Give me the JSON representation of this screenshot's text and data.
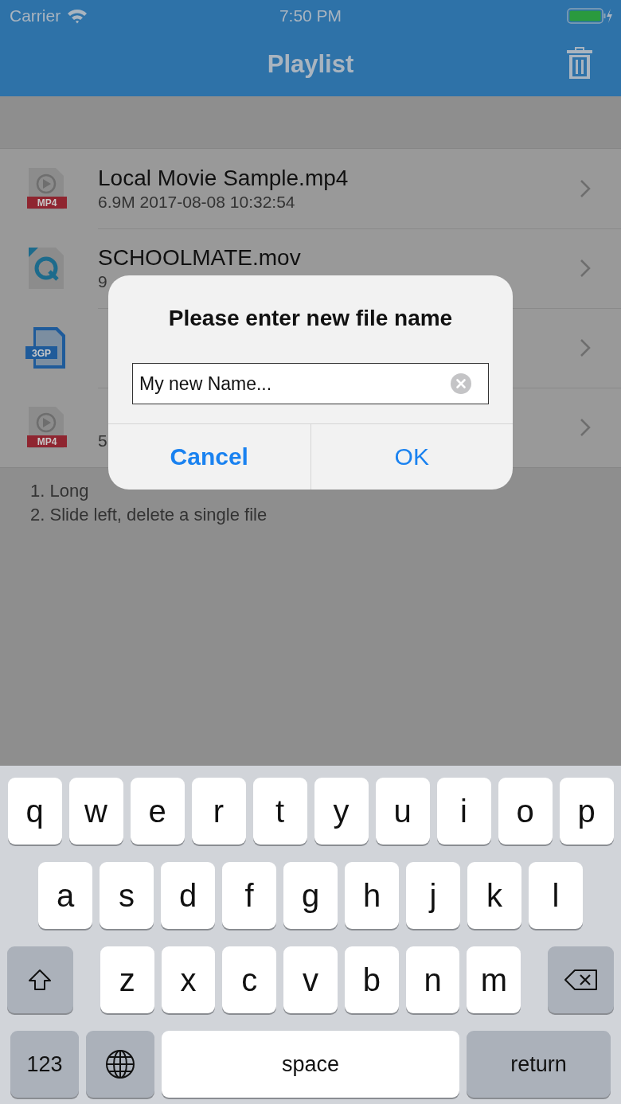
{
  "status_bar": {
    "carrier": "Carrier",
    "time": "7:50 PM"
  },
  "nav": {
    "title": "Playlist"
  },
  "files": [
    {
      "kind": "mp4",
      "icon_label": "MP4",
      "name": "Local Movie Sample.mp4",
      "detail": "6.9M  2017-08-08 10:32:54"
    },
    {
      "kind": "mov",
      "name": "SCHOOLMATE.mov",
      "detail": "9"
    },
    {
      "kind": "document",
      "icon_label": "3GP"
    },
    {
      "kind": "mp4",
      "icon_label": "MP4",
      "detail": "5"
    }
  ],
  "tips": [
    "1. Long",
    "2. Slide left, delete a single file"
  ],
  "dialog": {
    "title": "Please enter new file name",
    "field": {
      "value": "My new Name..."
    },
    "buttons": [
      {
        "label": "Cancel",
        "bold": true
      },
      {
        "label": "OK",
        "bold": false
      }
    ]
  },
  "keyboard": {
    "rows": [
      {
        "keys": [
          {
            "kind": "letter",
            "label": "q"
          },
          {
            "kind": "letter",
            "label": "w"
          },
          {
            "kind": "letter",
            "label": "e"
          },
          {
            "kind": "letter",
            "label": "r"
          },
          {
            "kind": "letter",
            "label": "t"
          },
          {
            "kind": "letter",
            "label": "y"
          },
          {
            "kind": "letter",
            "label": "u"
          },
          {
            "kind": "letter",
            "label": "i"
          },
          {
            "kind": "letter",
            "label": "o"
          },
          {
            "kind": "letter",
            "label": "p"
          }
        ]
      },
      {
        "keys": [
          {
            "kind": "letter",
            "label": "a"
          },
          {
            "kind": "letter",
            "label": "s"
          },
          {
            "kind": "letter",
            "label": "d"
          },
          {
            "kind": "letter",
            "label": "f"
          },
          {
            "kind": "letter",
            "label": "g"
          },
          {
            "kind": "letter",
            "label": "h"
          },
          {
            "kind": "letter",
            "label": "j"
          },
          {
            "kind": "letter",
            "label": "k"
          },
          {
            "kind": "letter",
            "label": "l"
          }
        ]
      },
      {
        "keys": [
          {
            "kind": "shift"
          },
          {
            "kind": "letter",
            "label": "z"
          },
          {
            "kind": "letter",
            "label": "x"
          },
          {
            "kind": "letter",
            "label": "c"
          },
          {
            "kind": "letter",
            "label": "v"
          },
          {
            "kind": "letter",
            "label": "b"
          },
          {
            "kind": "letter",
            "label": "n"
          },
          {
            "kind": "letter",
            "label": "m"
          },
          {
            "kind": "delete"
          }
        ]
      },
      {
        "keys": [
          {
            "kind": "numbers",
            "label": "123"
          },
          {
            "kind": "globe"
          },
          {
            "kind": "space",
            "label": "space"
          },
          {
            "kind": "return",
            "label": "return"
          }
        ]
      }
    ]
  }
}
